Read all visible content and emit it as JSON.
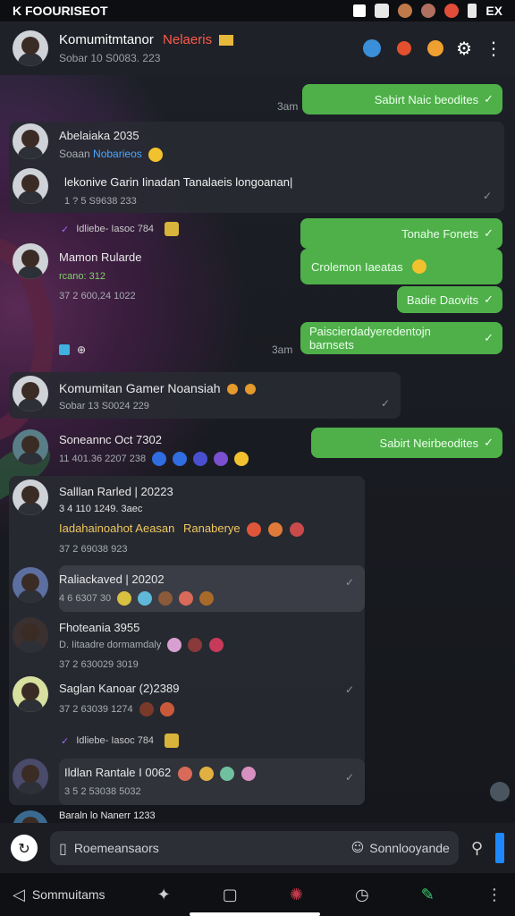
{
  "status": {
    "left_text": "K FOOURISEOT",
    "right_text": "EX"
  },
  "header": {
    "title": "Komumitmtanor",
    "tag": "Nelaeris",
    "subtitle": "Sobar 10 S0083. 223"
  },
  "messages": {
    "out1": "Sabirt Naic beodites",
    "out1_time": "3am",
    "m1_name": "Abelaiaka 2035",
    "m1_sub_prefix": "Soaan",
    "m1_sub_link": "Nobarieos",
    "m1_text": "lekonive Garin Iinadan Tanalaeis longoanan|",
    "m1_meta": "1 ? 5 S9638 233",
    "sys1": "Idliebe- Iasoc 784",
    "out2": "Tonahe Fonets",
    "m2_name": "Mamon Rularde",
    "m2_sub": "rcano: 312",
    "out3": "Crolemon Iaeatas",
    "m2_meta": "37 2 600,24 1022",
    "out4": "Badie Daovits",
    "out5": "Paiscierdadyeredentojn barnsets",
    "out5_time": "3am",
    "m3_name": "Komumitan Gamer Noansiah",
    "m3_meta": "Sobar 13 S0024 229",
    "m4_name": "Soneannc Oct 7302",
    "m4_meta": "11 401.36 2207 238",
    "out6": "Sabirt Neirbeodites",
    "m5_name": "Salllan Rarled | 20223",
    "m5_sub": "3 4 110 1249. 3aec",
    "m5_text": "Iadahainoahot Aeasan",
    "m5_text_link": "Ranaberye",
    "m5_meta": "37 2 69038 923",
    "m6_name": "Raliackaved | 20202",
    "m6_meta": "4 6 6307 30",
    "m7_name": "Fhoteania 3955",
    "m7_sub": "D. Iitaadre dormamdaly",
    "m7_meta": "37 2 630029 3019",
    "m8_name": "Saglan Kanoar (2)2389",
    "m8_meta": "37 2 63039 1274",
    "sys2": "Idliebe- Iasoc 784",
    "m9_name": "Ildlan Rantale I 0062",
    "m9_meta": "3 5 2 53038 5032",
    "m10_name": "Baraln lo Nanerr 1233"
  },
  "composer": {
    "placeholder": "Roemeansaors",
    "mode_label": "Sonnlooyande"
  },
  "navbar": {
    "label": "Sommuitams"
  },
  "colors": {
    "outgoing": "#4fb04a",
    "accent": "#1e88ff",
    "tag": "#ff5a4a"
  }
}
